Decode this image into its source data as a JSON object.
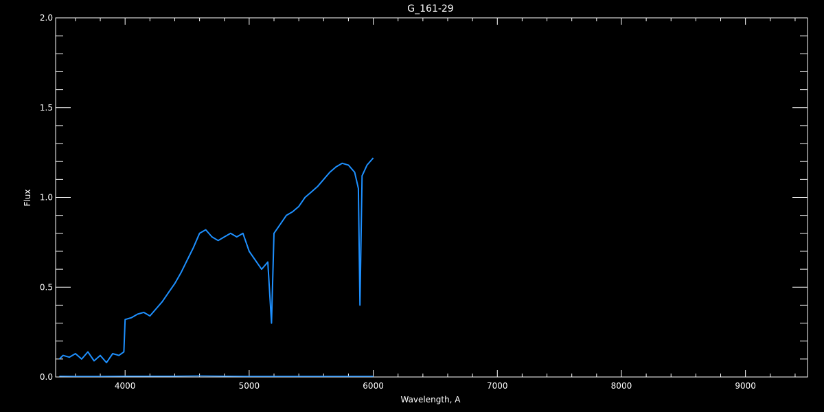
{
  "chart_data": {
    "type": "line",
    "title": "G_161-29",
    "xlabel": "Wavelength, A",
    "ylabel": "Flux",
    "xlim": [
      3440,
      9500
    ],
    "ylim": [
      0,
      2.0
    ],
    "xticks": [
      4000,
      5000,
      6000,
      7000,
      8000,
      9000
    ],
    "xtick_labels": [
      "4000",
      "5000",
      "6000",
      "7000",
      "8000",
      "9000"
    ],
    "yticks": [
      0.0,
      0.5,
      1.0,
      1.5,
      2.0
    ],
    "ytick_labels": [
      "0.0",
      "0.5",
      "1.0",
      "1.5",
      "2.0"
    ],
    "x_minor_step": 200,
    "y_minor_step": 0.1,
    "grid": false,
    "background": "#000000",
    "axis_color": "#ffffff",
    "series": [
      {
        "color": "#1e90ff",
        "x": [
          3470,
          3500,
          3550,
          3600,
          3650,
          3700,
          3750,
          3800,
          3850,
          3900,
          3950,
          3990,
          4000,
          4050,
          4100,
          4150,
          4200,
          4250,
          4300,
          4350,
          4400,
          4450,
          4500,
          4550,
          4600,
          4650,
          4700,
          4750,
          4800,
          4850,
          4900,
          4950,
          5000,
          5050,
          5100,
          5150,
          5180,
          5200,
          5250,
          5300,
          5350,
          5400,
          5450,
          5500,
          5550,
          5600,
          5650,
          5700,
          5750,
          5800,
          5850,
          5880,
          5893,
          5910,
          5950,
          6000
        ],
        "y": [
          0.1,
          0.12,
          0.11,
          0.13,
          0.1,
          0.14,
          0.09,
          0.12,
          0.08,
          0.13,
          0.12,
          0.14,
          0.32,
          0.33,
          0.35,
          0.36,
          0.34,
          0.38,
          0.42,
          0.47,
          0.52,
          0.58,
          0.65,
          0.72,
          0.8,
          0.82,
          0.78,
          0.76,
          0.78,
          0.8,
          0.78,
          0.8,
          0.7,
          0.65,
          0.6,
          0.64,
          0.3,
          0.8,
          0.85,
          0.9,
          0.92,
          0.95,
          1.0,
          1.03,
          1.06,
          1.1,
          1.14,
          1.17,
          1.19,
          1.18,
          1.14,
          1.05,
          0.4,
          1.12,
          1.18,
          1.22
        ]
      },
      {
        "color": "#1e90ff",
        "x": [
          3470,
          3600,
          3800,
          4000,
          4200,
          4400,
          4600,
          4800,
          5000,
          5200,
          5400,
          5600,
          5800,
          6000
        ],
        "y": [
          0.005,
          0.004,
          0.004,
          0.005,
          0.005,
          0.005,
          0.006,
          0.005,
          0.004,
          0.004,
          0.004,
          0.004,
          0.004,
          0.004
        ]
      }
    ]
  }
}
